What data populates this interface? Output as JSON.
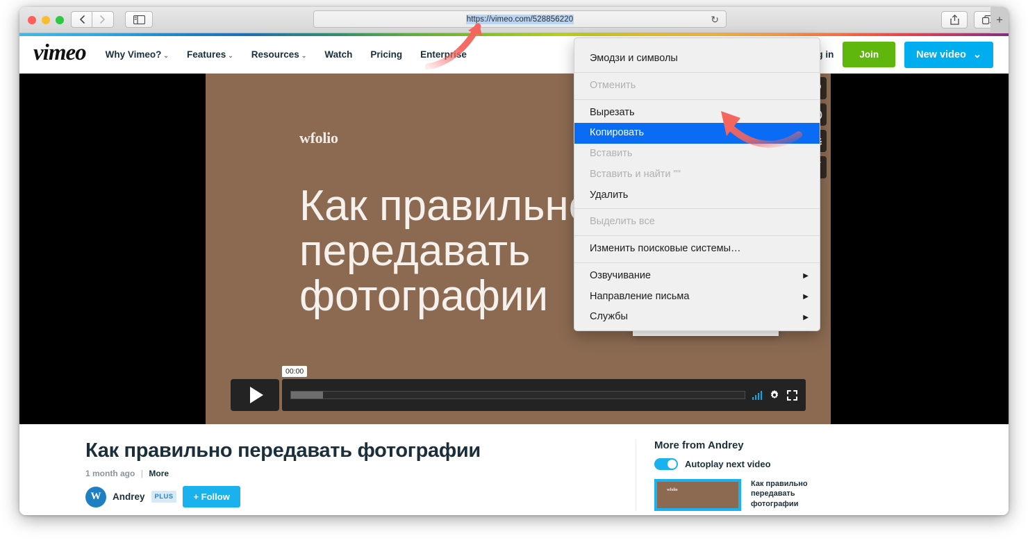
{
  "browser": {
    "url": "https://vimeo.com/528856220",
    "url_selected": true,
    "back_label": "‹",
    "forward_label": "›",
    "reload_label": "↻",
    "plus_label": "+",
    "icons": {
      "sidebar": "sidebar-icon",
      "share": "share-icon",
      "tabs": "tabs-icon"
    }
  },
  "context_menu": {
    "items": [
      {
        "label": "Эмодзи и символы",
        "state": "enabled",
        "submenu": false
      },
      {
        "separator": true
      },
      {
        "label": "Отменить",
        "state": "disabled",
        "submenu": false
      },
      {
        "separator": true
      },
      {
        "label": "Вырезать",
        "state": "enabled",
        "submenu": false
      },
      {
        "label": "Копировать",
        "state": "selected",
        "submenu": false
      },
      {
        "label": "Вставить",
        "state": "disabled",
        "submenu": false
      },
      {
        "label": "Вставить и найти \"\"",
        "state": "disabled",
        "submenu": false
      },
      {
        "label": "Удалить",
        "state": "enabled",
        "submenu": false
      },
      {
        "separator": true
      },
      {
        "label": "Выделить все",
        "state": "disabled",
        "submenu": false
      },
      {
        "separator": true
      },
      {
        "label": "Изменить поисковые системы…",
        "state": "enabled",
        "submenu": false
      },
      {
        "separator": true
      },
      {
        "label": "Озвучивание",
        "state": "enabled",
        "submenu": true
      },
      {
        "label": "Направление письма",
        "state": "enabled",
        "submenu": true
      },
      {
        "label": "Службы",
        "state": "enabled",
        "submenu": true
      }
    ],
    "submenu_glyph": "▶"
  },
  "site": {
    "logo": "vimeo",
    "nav": [
      {
        "label": "Why Vimeo?",
        "has_caret": true
      },
      {
        "label": "Features",
        "has_caret": true
      },
      {
        "label": "Resources",
        "has_caret": true
      },
      {
        "label": "Watch",
        "has_caret": false
      },
      {
        "label": "Pricing",
        "has_caret": false
      },
      {
        "label": "Enterprise",
        "has_caret": false
      }
    ],
    "nav_right": {
      "search_icon": "search-icon",
      "login_label": "Log in",
      "join_label": "Join",
      "new_video_label": "New video",
      "new_video_caret": "⌄",
      "join_color": "#5fb70d",
      "new_video_color": "#00adef"
    }
  },
  "player": {
    "brand_overlay": "wfolio",
    "title_overlay": "Как правильно передавать фотографии",
    "time_label": "00:00",
    "progress_percent": 7,
    "play_icon": "play-icon",
    "quality_icon": "quality-bars-icon",
    "settings_icon": "gear-icon",
    "fullscreen_icon": "fullscreen-icon",
    "side_actions": [
      {
        "name": "like-icon",
        "glyph": "♥"
      },
      {
        "name": "watch-later-icon",
        "glyph": "◴"
      },
      {
        "name": "collections-icon",
        "glyph": "▤"
      },
      {
        "name": "share-icon",
        "glyph": "➤"
      }
    ]
  },
  "video_info": {
    "title": "Как правильно передавать фотографии",
    "age": "1 month ago",
    "separator": "|",
    "more_label": "More",
    "owner": {
      "avatar_letter": "W",
      "name": "Andrey",
      "badge": "PLUS",
      "follow_label": "+ Follow"
    }
  },
  "sidebar": {
    "heading": "More from Andrey",
    "autoplay_label": "Autoplay next video",
    "autoplay_on": true,
    "items": [
      {
        "thumb_logo": "wfolio",
        "caption": "Как правильно передавать фотографии",
        "active": true
      }
    ]
  },
  "annotations": {
    "arrow_to_url": "red-arrow-pointing-to-url",
    "arrow_to_copy": "red-arrow-pointing-to-copy-menu-item",
    "color": "#f4655e"
  }
}
